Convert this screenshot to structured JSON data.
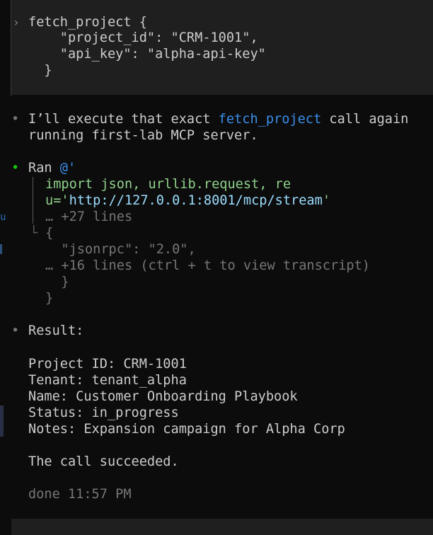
{
  "prompt": {
    "chevron": "›",
    "lines": [
      "fetch_project {",
      "    \"project_id\": \"CRM-1001\",",
      "    \"api_key\": \"alpha-api-key\"",
      "  }"
    ]
  },
  "message1": {
    "bullet": "•",
    "text_before": "I’ll execute that exact ",
    "highlight": "fetch_project",
    "text_after": " call again",
    "line2": "running first-lab MCP server."
  },
  "tool_call": {
    "bullet": "•",
    "ran_label": "Ran ",
    "ran_cmd": "@'",
    "code_line1": "import json, urllib.request, re",
    "code_line2_prefix": "u='",
    "code_line2_url": "http://127.0.0.1:8001/mcp/stream",
    "code_line2_suffix": "'",
    "collapsed1": "… +27 lines",
    "out_line1": "{",
    "out_line2": "  \"jsonrpc\": \"2.0\",",
    "collapsed2": "… +16 lines (ctrl + t to view transcript)",
    "out_line3": "  }",
    "out_line4": "}"
  },
  "result": {
    "bullet": "•",
    "heading": "Result:",
    "fields": [
      "Project ID: CRM-1001",
      "Tenant: tenant_alpha",
      "Name: Customer Onboarding Playbook",
      "Status: in_progress",
      "Notes: Expansion campaign for Alpha Corp"
    ],
    "conclusion": "The call succeeded.",
    "done": "done 11:57 PM"
  },
  "gutter_glyph": "u",
  "colors": {
    "background": "#0c0c0c",
    "block_bg": "#1f1f1f",
    "text": "#cccccc",
    "dim": "#767676",
    "accent_blue": "#3b8eea",
    "code_green": "#8fd18a",
    "success_green": "#16c60c"
  }
}
